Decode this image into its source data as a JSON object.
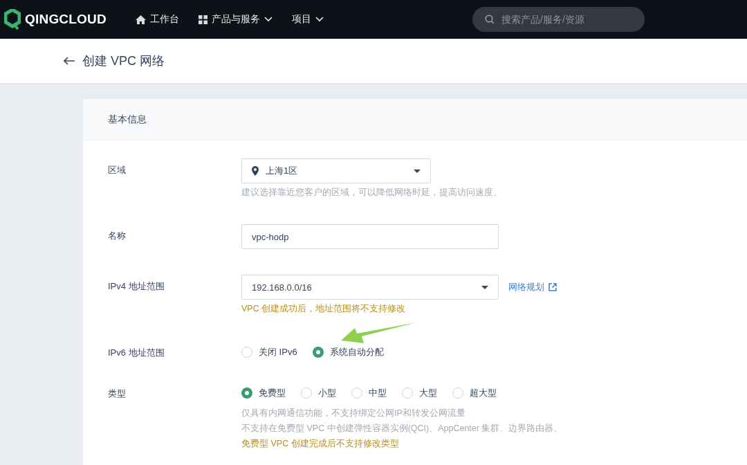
{
  "topbar": {
    "brand": "QINGCLOUD",
    "nav": [
      {
        "label": "工作台",
        "kind": "home"
      },
      {
        "label": "产品与服务",
        "kind": "menu"
      },
      {
        "label": "项目",
        "kind": "dropdown"
      }
    ],
    "search": {
      "placeholder": "搜索产品/服务/资源"
    }
  },
  "header": {
    "title": "创建 VPC 网络"
  },
  "section": {
    "title": "基本信息"
  },
  "fields": [
    {
      "kind": "select",
      "label": "区域",
      "value": "上海1区",
      "location": true,
      "hints": [
        {
          "text": "建议选择靠近您客户的区域，可以降低网络时延，提高访问速度。",
          "kind": "info"
        }
      ]
    },
    {
      "kind": "input",
      "label": "名称",
      "value": "vpc-hodp"
    },
    {
      "kind": "select",
      "label": "IPv4 地址范围",
      "value": "192.168.0.0/16",
      "location": false,
      "link": "网络规划",
      "hints": [
        {
          "text": "VPC 创建成功后，地址范围将不支持修改",
          "kind": "warning"
        }
      ]
    },
    {
      "kind": "radio",
      "label": "IPv6 地址范围",
      "annotated": true,
      "options": [
        {
          "label": "关闭 IPv6",
          "selected": false
        },
        {
          "label": "系统自动分配",
          "selected": true
        }
      ]
    },
    {
      "kind": "radio",
      "label": "类型",
      "annotated": false,
      "options": [
        {
          "label": "免费型",
          "selected": true
        },
        {
          "label": "小型",
          "selected": false
        },
        {
          "label": "中型",
          "selected": false
        },
        {
          "label": "大型",
          "selected": false
        },
        {
          "label": "超大型",
          "selected": false
        }
      ],
      "hints": [
        {
          "text": "仅具有内网通信功能，不支持绑定公网IP和转发公网流量",
          "kind": "info"
        },
        {
          "text": "不支持在免费型 VPC 中创建弹性容器实例(QCI)、AppCenter 集群、边界路由器。",
          "kind": "info"
        },
        {
          "text": "免费型 VPC 创建完成后不支持修改类型",
          "kind": "warning"
        }
      ]
    }
  ]
}
